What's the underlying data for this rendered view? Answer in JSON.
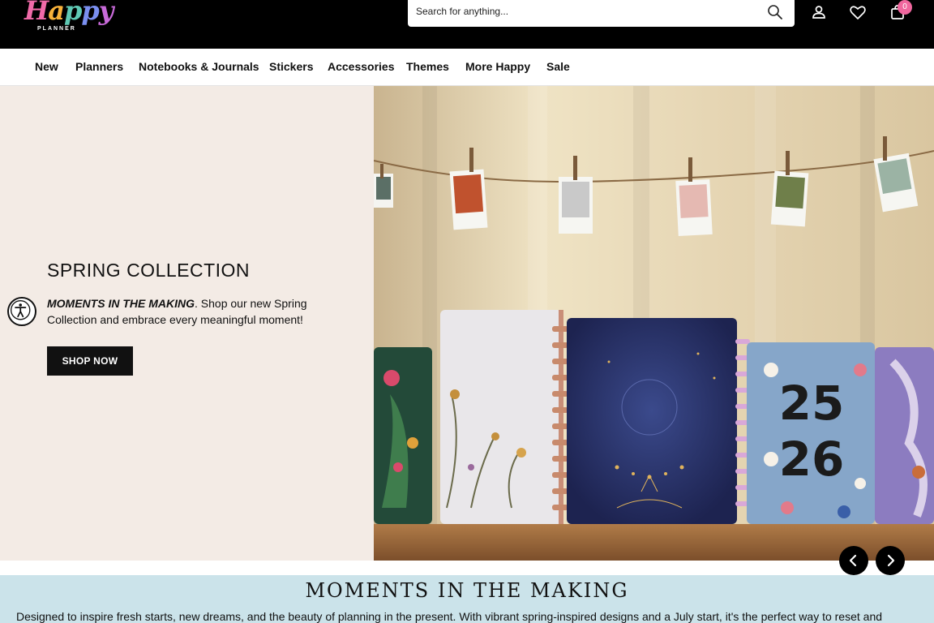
{
  "header": {
    "logo_text": "Happy",
    "logo_sub": "PLANNER",
    "search_placeholder": "Search for anything...",
    "cart_count": "0"
  },
  "nav": {
    "items": [
      "New",
      "Planners",
      "Notebooks & Journals",
      "Stickers",
      "Accessories",
      "Themes",
      "More Happy",
      "Sale"
    ]
  },
  "hero": {
    "title": "SPRING COLLECTION",
    "desc_bold": "MOMENTS IN THE MAKING",
    "desc_rest": ". Shop our new Spring Collection and embrace every meaningful moment!",
    "cta": "SHOP NOW",
    "planner_year_top": "25",
    "planner_year_bottom": "26"
  },
  "band": {
    "title": "MOMENTS IN THE MAKING",
    "text": "Designed to inspire fresh starts, new dreams, and the beauty of planning in the present. With vibrant spring-inspired designs and a July start, it's the perfect way to reset and"
  },
  "colors": {
    "header_bg": "#000000",
    "hero_left_bg": "#f3ebe5",
    "band_bg": "#cbe3ea",
    "cart_badge": "#f0679e"
  }
}
